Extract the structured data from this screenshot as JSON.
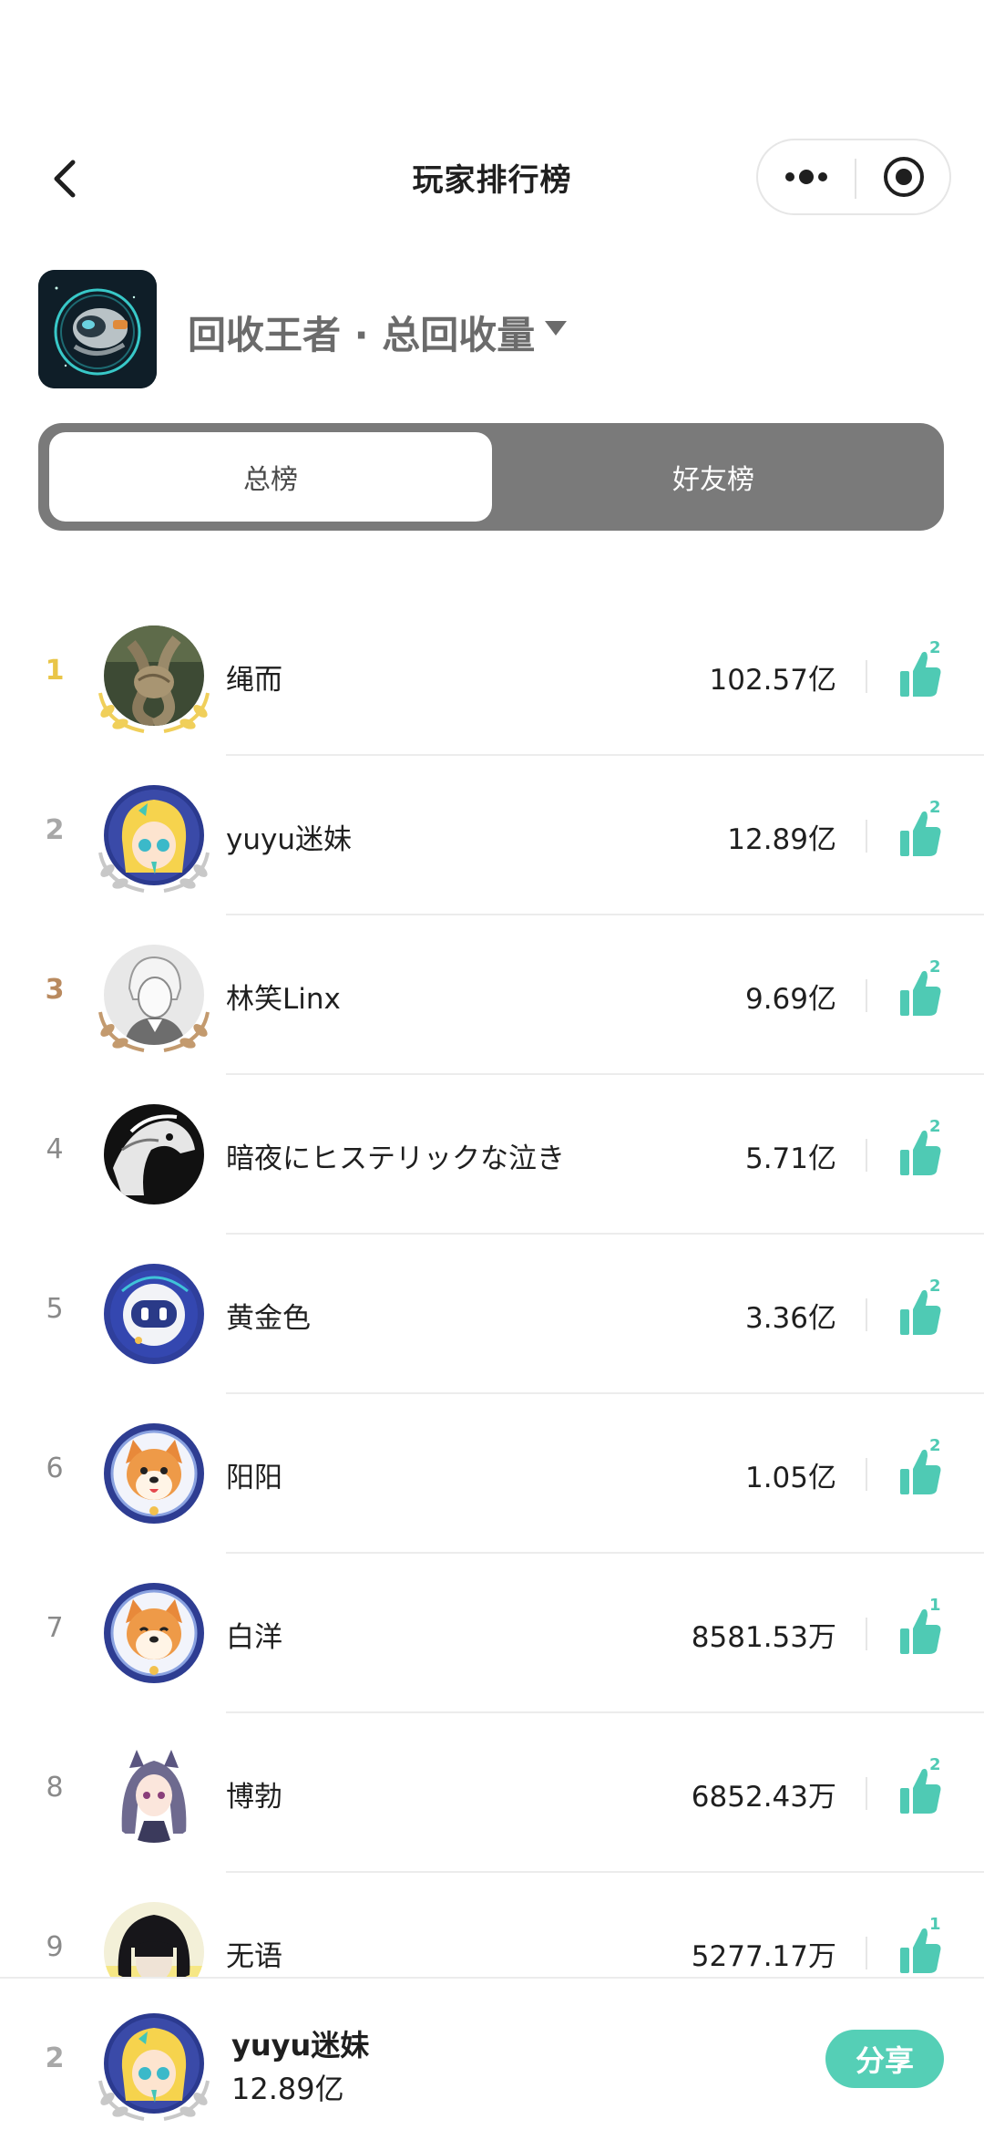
{
  "nav": {
    "title": "玩家排行榜",
    "back_icon": "chevron-left-icon",
    "more_icon": "more-dots-icon",
    "close_icon": "target-close-icon"
  },
  "game": {
    "title": "回收王者 · 总回收量",
    "icon": "astronaut-helmet-icon",
    "caret_icon": "caret-down-icon"
  },
  "tabs": [
    {
      "label": "总榜",
      "active": true
    },
    {
      "label": "好友榜",
      "active": false
    }
  ],
  "colors": {
    "accent": "#55cfb6",
    "like": "#4fcab4",
    "rank_gold": "#e9c547",
    "rank_silver": "#a8a8a8",
    "rank_bronze": "#b98a5f",
    "tab_bg": "#7a7a7a"
  },
  "rows": [
    {
      "rank": "1",
      "name": "绳而",
      "score": "102.57亿",
      "likes": "2",
      "avatar": "rope-knot-avatar"
    },
    {
      "rank": "2",
      "name": "yuyu迷妹",
      "score": "12.89亿",
      "likes": "2",
      "avatar": "anime-girl-avatar"
    },
    {
      "rank": "3",
      "name": "林笑Linx",
      "score": "9.69亿",
      "likes": "2",
      "avatar": "sketch-boy-avatar"
    },
    {
      "rank": "4",
      "name": "暗夜にヒステリックな泣き",
      "score": "5.71亿",
      "likes": "2",
      "avatar": "bw-horse-avatar"
    },
    {
      "rank": "5",
      "name": "黄金色",
      "score": "3.36亿",
      "likes": "2",
      "avatar": "robot-avatar"
    },
    {
      "rank": "6",
      "name": "阳阳",
      "score": "1.05亿",
      "likes": "2",
      "avatar": "shiba-astronaut-avatar"
    },
    {
      "rank": "7",
      "name": "白洋",
      "score": "8581.53万",
      "likes": "1",
      "avatar": "shiba-astronaut-avatar"
    },
    {
      "rank": "8",
      "name": "博勃",
      "score": "6852.43万",
      "likes": "2",
      "avatar": "anime-purple-hair-avatar"
    },
    {
      "rank": "9",
      "name": "无语",
      "score": "5277.17万",
      "likes": "1",
      "avatar": "dark-hair-avatar"
    }
  ],
  "me": {
    "rank": "2",
    "name": "yuyu迷妹",
    "score": "12.89亿",
    "avatar": "anime-girl-avatar",
    "share_label": "分享"
  }
}
